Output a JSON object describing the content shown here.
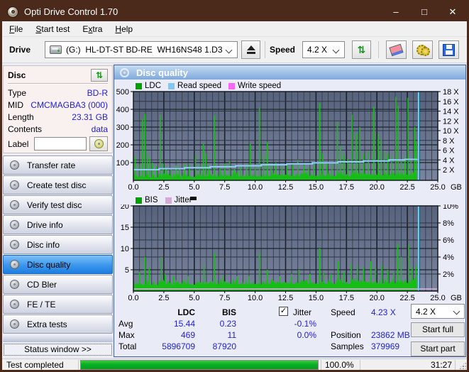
{
  "window": {
    "title": "Opti Drive Control 1.70",
    "controls": [
      {
        "name": "minimize-button",
        "glyph": "–"
      },
      {
        "name": "maximize-button",
        "glyph": "□"
      },
      {
        "name": "close-button",
        "glyph": "✕"
      }
    ]
  },
  "menu": {
    "items": [
      {
        "label": "File",
        "underline": "F"
      },
      {
        "label": "Start test",
        "underline": "S"
      },
      {
        "label": "Extra",
        "underline": "x"
      },
      {
        "label": "Help",
        "underline": "H"
      }
    ]
  },
  "toolbar": {
    "drive_label": "Drive",
    "drive_value": "(G:)  HL-DT-ST BD-RE  WH16NS48 1.D3",
    "speed_label": "Speed",
    "speed_value": "4.2 X"
  },
  "sidebar": {
    "disc_panel": {
      "title": "Disc",
      "rows": [
        {
          "label": "Type",
          "value": "BD-R"
        },
        {
          "label": "MID",
          "value": "CMCMAGBA3 (000)"
        },
        {
          "label": "Length",
          "value": "23.31 GB"
        },
        {
          "label": "Contents",
          "value": "data"
        }
      ],
      "label_row": {
        "label": "Label",
        "value": ""
      }
    },
    "buttons": [
      {
        "label": "Transfer rate",
        "active": false
      },
      {
        "label": "Create test disc",
        "active": false
      },
      {
        "label": "Verify test disc",
        "active": false
      },
      {
        "label": "Drive info",
        "active": false
      },
      {
        "label": "Disc info",
        "active": false
      },
      {
        "label": "Disc quality",
        "active": true
      },
      {
        "label": "CD Bler",
        "active": false
      },
      {
        "label": "FE / TE",
        "active": false
      },
      {
        "label": "Extra tests",
        "active": false
      }
    ],
    "status_window_button": "Status window >>"
  },
  "panel": {
    "title": "Disc quality"
  },
  "chart_data": [
    {
      "type": "area",
      "title": "LDC errors and read speed vs disc position",
      "legend": [
        {
          "label": "LDC",
          "color": "#00a000"
        },
        {
          "label": "Read speed",
          "color": "#7fc8f5"
        },
        {
          "label": "Write speed",
          "color": "#f868f8"
        }
      ],
      "x_axis": {
        "unit": "GB",
        "min": 0,
        "max": 25,
        "major_step": 2.5,
        "minor_step": 0.5,
        "ticks": [
          "0.0",
          "2.5",
          "5.0",
          "7.5",
          "10.0",
          "12.5",
          "15.0",
          "17.5",
          "20.0",
          "22.5",
          "25.0"
        ]
      },
      "y_left": {
        "min": 0,
        "max": 500,
        "ticks": [
          100,
          200,
          300,
          400,
          500
        ]
      },
      "y_right": {
        "unit": "X",
        "ticks": [
          {
            "label": "2 X",
            "left_units": 60
          },
          {
            "label": "4 X",
            "left_units": 115
          },
          {
            "label": "6 X",
            "left_units": 170
          },
          {
            "label": "8 X",
            "left_units": 225
          },
          {
            "label": "10 X",
            "left_units": 280
          },
          {
            "label": "12 X",
            "left_units": 335
          },
          {
            "label": "14 X",
            "left_units": 390
          },
          {
            "label": "16 X",
            "left_units": 445
          },
          {
            "label": "18 X",
            "left_units": 500
          }
        ]
      },
      "series": {
        "color": "#17bd17",
        "baseline": {
          "min": 14,
          "max": 52,
          "drift": 0.55
        },
        "spikes": [
          [
            0.15,
            130
          ],
          [
            0.45,
            90
          ],
          [
            0.75,
            345
          ],
          [
            0.95,
            375
          ],
          [
            1.15,
            150
          ],
          [
            1.35,
            125
          ],
          [
            1.55,
            100
          ],
          [
            1.9,
            80
          ],
          [
            2.2,
            370
          ],
          [
            2.45,
            95
          ],
          [
            2.7,
            70
          ],
          [
            3.1,
            60
          ],
          [
            3.5,
            85
          ],
          [
            3.8,
            70
          ],
          [
            4.2,
            95
          ],
          [
            4.6,
            85
          ],
          [
            5.1,
            145
          ],
          [
            5.45,
            90
          ],
          [
            5.75,
            205
          ],
          [
            5.95,
            150
          ],
          [
            6.2,
            80
          ],
          [
            6.65,
            365
          ],
          [
            7.1,
            75
          ],
          [
            7.5,
            95
          ],
          [
            7.9,
            110
          ],
          [
            8.3,
            65
          ],
          [
            8.8,
            75
          ],
          [
            9.3,
            90
          ],
          [
            9.6,
            205
          ],
          [
            10.0,
            90
          ],
          [
            10.35,
            410
          ],
          [
            10.7,
            145
          ],
          [
            11.0,
            215
          ],
          [
            11.3,
            90
          ],
          [
            11.7,
            100
          ],
          [
            12.2,
            80
          ],
          [
            12.6,
            95
          ],
          [
            13.1,
            90
          ],
          [
            13.5,
            115
          ],
          [
            14.0,
            85
          ],
          [
            14.4,
            75
          ],
          [
            14.8,
            90
          ],
          [
            15.3,
            435
          ],
          [
            15.55,
            150
          ],
          [
            15.9,
            95
          ],
          [
            16.3,
            100
          ],
          [
            16.75,
            330
          ],
          [
            17.0,
            195
          ],
          [
            17.3,
            145
          ],
          [
            17.6,
            120
          ],
          [
            17.95,
            370
          ],
          [
            18.3,
            265
          ],
          [
            18.6,
            300
          ],
          [
            18.9,
            150
          ],
          [
            19.3,
            165
          ],
          [
            19.75,
            415
          ],
          [
            20.1,
            260
          ],
          [
            20.35,
            230
          ],
          [
            20.6,
            160
          ],
          [
            20.9,
            150
          ],
          [
            21.2,
            140
          ],
          [
            21.55,
            470
          ],
          [
            21.75,
            420
          ],
          [
            22.0,
            110
          ],
          [
            22.3,
            130
          ],
          [
            22.55,
            465
          ],
          [
            22.8,
            125
          ],
          [
            23.1,
            300
          ],
          [
            23.25,
            220
          ]
        ],
        "read_speed_steps": [
          [
            0,
            2.0
          ],
          [
            2.1,
            2.2
          ],
          [
            4.2,
            2.4
          ],
          [
            6.3,
            2.6
          ],
          [
            8.4,
            2.8
          ],
          [
            10.5,
            3.0
          ],
          [
            12.6,
            3.2
          ],
          [
            14.7,
            3.4
          ],
          [
            16.8,
            3.6
          ],
          [
            18.9,
            3.8
          ],
          [
            21.0,
            4.0
          ],
          [
            22.3,
            4.1
          ],
          [
            23.3,
            4.2
          ]
        ],
        "speed_map": {
          "base_x": 2,
          "base_units": 60,
          "units_per_x": 27.5
        },
        "write_speed": [],
        "data_end_gb": 23.31,
        "cursor_gb": 23.42
      }
    },
    {
      "type": "area",
      "title": "BIS errors and jitter vs disc position",
      "legend": [
        {
          "label": "BIS",
          "color": "#00a000"
        },
        {
          "label": "Jitter",
          "color": "#d8a8d8"
        }
      ],
      "x_axis": {
        "unit": "GB",
        "min": 0,
        "max": 25,
        "major_step": 2.5,
        "minor_step": 0.5,
        "ticks": [
          "0.0",
          "2.5",
          "5.0",
          "7.5",
          "10.0",
          "12.5",
          "15.0",
          "17.5",
          "20.0",
          "22.5",
          "25.0"
        ]
      },
      "y_left": {
        "min": 0,
        "max": 20,
        "ticks": [
          5,
          10,
          15,
          20
        ]
      },
      "y_right": {
        "unit": "%",
        "ticks": [
          {
            "label": "2%",
            "left_units": 4
          },
          {
            "label": "4%",
            "left_units": 8
          },
          {
            "label": "6%",
            "left_units": 12
          },
          {
            "label": "8%",
            "left_units": 16
          },
          {
            "label": "10%",
            "left_units": 20
          }
        ]
      },
      "series": {
        "color": "#17bd17",
        "baseline": {
          "min": 1.3,
          "max": 3.1,
          "drift": 0.02
        },
        "spikes": [
          [
            0.5,
            4.5
          ],
          [
            0.95,
            8
          ],
          [
            1.3,
            5.5
          ],
          [
            2.3,
            8
          ],
          [
            2.6,
            4
          ],
          [
            3.3,
            3.5
          ],
          [
            4.5,
            3.5
          ],
          [
            5.8,
            6
          ],
          [
            6.65,
            9
          ],
          [
            7.4,
            3.5
          ],
          [
            8.5,
            3.5
          ],
          [
            9.5,
            3.5
          ],
          [
            10.35,
            9
          ],
          [
            11.0,
            5
          ],
          [
            12.0,
            3.5
          ],
          [
            13.0,
            4
          ],
          [
            13.6,
            5
          ],
          [
            14.5,
            4
          ],
          [
            15.3,
            10
          ],
          [
            15.6,
            4.5
          ],
          [
            16.2,
            4
          ],
          [
            16.8,
            7
          ],
          [
            17.3,
            4.5
          ],
          [
            17.9,
            6.5
          ],
          [
            18.4,
            6
          ],
          [
            18.9,
            5.5
          ],
          [
            19.5,
            7
          ],
          [
            19.9,
            5.5
          ],
          [
            20.4,
            6
          ],
          [
            20.9,
            5
          ],
          [
            21.4,
            4.5
          ],
          [
            21.7,
            11
          ],
          [
            22.0,
            8
          ],
          [
            22.6,
            11
          ],
          [
            22.9,
            5.5
          ],
          [
            23.2,
            6
          ]
        ],
        "jitter_flat_units": 0.5,
        "data_end_gb": 23.31,
        "cursor_gb": 23.42
      }
    }
  ],
  "stats": {
    "headers": {
      "ldc": "LDC",
      "bis": "BIS",
      "jitter": "Jitter"
    },
    "jitter_checked": true,
    "rows": [
      {
        "label": "Avg",
        "ldc": "15.44",
        "bis": "0.23",
        "jitter": "-0.1%"
      },
      {
        "label": "Max",
        "ldc": "469",
        "bis": "11",
        "jitter": "0.0%"
      },
      {
        "label": "Total",
        "ldc": "5896709",
        "bis": "87920",
        "jitter": ""
      }
    ],
    "speed": {
      "label": "Speed",
      "value": "4.23 X"
    },
    "position": {
      "label": "Position",
      "value": "23862 MB"
    },
    "samples": {
      "label": "Samples",
      "value": "379969"
    },
    "speed_select": "4.2 X",
    "start_full": "Start full",
    "start_part": "Start part"
  },
  "statusbar": {
    "status": "Test completed",
    "progress_percent": "100.0%",
    "progress_value": 100,
    "elapsed": "31:27"
  },
  "icons": {
    "check": "✓",
    "refresh": "⇅"
  }
}
